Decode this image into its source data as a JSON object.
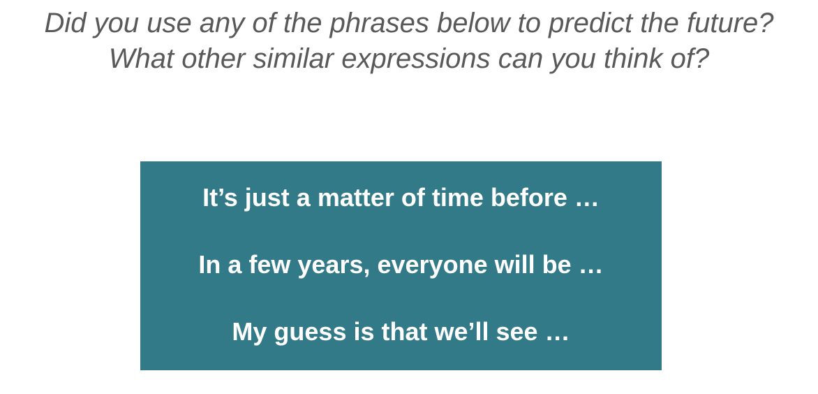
{
  "prompt": {
    "lines": [
      "Did you use any of the phrases below to predict the future?",
      "What other similar expressions can you think of?"
    ]
  },
  "phrases": {
    "items": [
      "It’s just a matter of time before …",
      "In a few years, everyone will be …",
      "My guess is that we’ll see …"
    ]
  },
  "colors": {
    "box_background": "#337a89",
    "prompt_text": "#595959",
    "phrase_text": "#ffffff"
  }
}
